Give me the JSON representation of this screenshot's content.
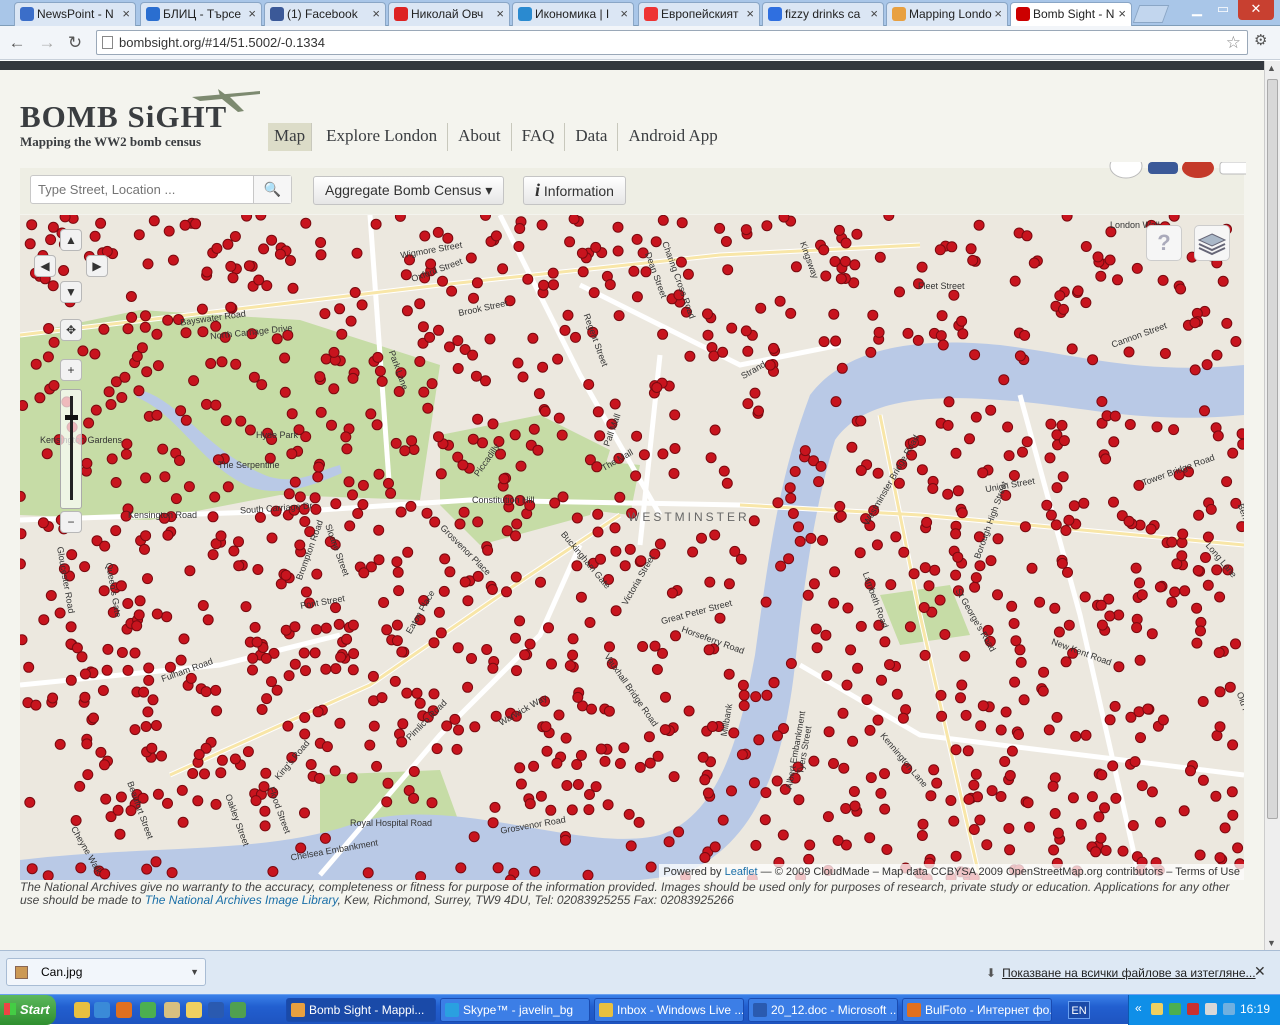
{
  "browser": {
    "tabs": [
      {
        "label": "NewsPoint - N",
        "color": "#3b6ec9"
      },
      {
        "label": "БЛИЦ - Търсе",
        "color": "#2a6ed0"
      },
      {
        "label": "(1) Facebook",
        "color": "#3b5998"
      },
      {
        "label": "Николай Овч",
        "color": "#d22"
      },
      {
        "label": "Икономика | I",
        "color": "#2a8ad0"
      },
      {
        "label": "Европейският",
        "color": "#e33"
      },
      {
        "label": "fizzy drinks ca",
        "color": "#2f6fe0"
      },
      {
        "label": "Mapping Londo",
        "color": "#e8a040"
      },
      {
        "label": "Bomb Sight - N",
        "color": "#c00"
      }
    ],
    "url": "bombsight.org/#14/51.5002/-0.1334",
    "window_controls": [
      "minimize-icon",
      "maximize-icon",
      "close-icon"
    ]
  },
  "site": {
    "logo": "BOMB SiGHT",
    "tagline": "Mapping the WW2 bomb census",
    "nav": [
      "Map",
      "Explore London",
      "About",
      "FAQ",
      "Data",
      "Android App"
    ],
    "nav_active": "Map"
  },
  "toolbar": {
    "search_placeholder": "Type Street, Location ...",
    "aggregate_label": "Aggregate Bomb Census",
    "info_label": "Information"
  },
  "map": {
    "district_label": "WESTMINSTER",
    "street_labels": [
      "Bayswater Road",
      "North Carriage Drive",
      "Hyde Park",
      "The Serpentine",
      "Kensington Gardens",
      "Kensington Road",
      "South Carriage Dr",
      "Park Lane",
      "Oxford Street",
      "Brook Street",
      "Piccadilly",
      "Pall Mall",
      "The Mall",
      "Constitution Hill",
      "Buckingham Gate",
      "Victoria Street",
      "Strand",
      "Fleet Street",
      "Cannon Street",
      "Kingsway",
      "Charing Cross Road",
      "Regent Street",
      "Wigmore Street",
      "Great Peter Street",
      "Horseferry Road",
      "Vauxhall Bridge Road",
      "Warwick Way",
      "Pimlico Road",
      "King's Road",
      "Fulham Road",
      "Sloane Street",
      "Brompton Road",
      "Pont Street",
      "Eaton Place",
      "Grosvenor Place",
      "Kennington Lane",
      "St George's Road",
      "Borough High Street",
      "Union Street",
      "New Kent Road",
      "Old Kent Road",
      "Long Lane",
      "Bermondsey Street",
      "Tower Bridge Road",
      "Lambeth Road",
      "Westminster Bridge Road",
      "Royal Hospital Road",
      "Chelsea Embankment",
      "Grosvenor Road",
      "Millbank",
      "Albert Embankment",
      "Tyers Street",
      "London Wall",
      "Dean Street",
      "Queen's Gate",
      "Gloucester Road",
      "Oakley Street",
      "Flood Street",
      "Beaufort Street",
      "Cheyne Walk"
    ],
    "controls": {
      "pan_up": "▲",
      "pan_down": "▼",
      "pan_left": "◀",
      "pan_right": "▶",
      "zoom_in": "+",
      "zoom_out": "−",
      "help": "?"
    },
    "zoom_level": 14,
    "attribution_prefix": "Powered by",
    "attribution_link": "Leaflet",
    "attribution_rest": "— © 2009 CloudMade – Map data CCBYSA 2009 OpenStreetMap.org contributors – Terms of Use",
    "marker_color": "#c8141e"
  },
  "disclaimer": {
    "text_before": "The National Archives give no warranty to the accuracy, completeness or fitness for purpose of the information provided. Images should be used only for purposes of research, private study or education. Applications for any other use should be made to ",
    "link": "The National Archives Image Library",
    "text_after": ", Kew, Richmond, Surrey, TW9 4DU, Tel: 02083925255 Fax: 02083925266"
  },
  "downloads": {
    "file": "Can.jpg",
    "show_all": "Показване на всички файлове за изтегляне..."
  },
  "taskbar": {
    "start": "Start",
    "items": [
      {
        "label": "Bomb Sight - Mappi...",
        "color": "#e8a040"
      },
      {
        "label": "Skype™ - javelin_bg",
        "color": "#2aa0e0"
      },
      {
        "label": "Inbox - Windows Live ...",
        "color": "#e8c040"
      },
      {
        "label": "20_12.doc - Microsoft ...",
        "color": "#2a5ab0"
      },
      {
        "label": "BulFoto - Интернет фо...",
        "color": "#e07020"
      }
    ],
    "language": "EN",
    "clock": "16:19"
  }
}
